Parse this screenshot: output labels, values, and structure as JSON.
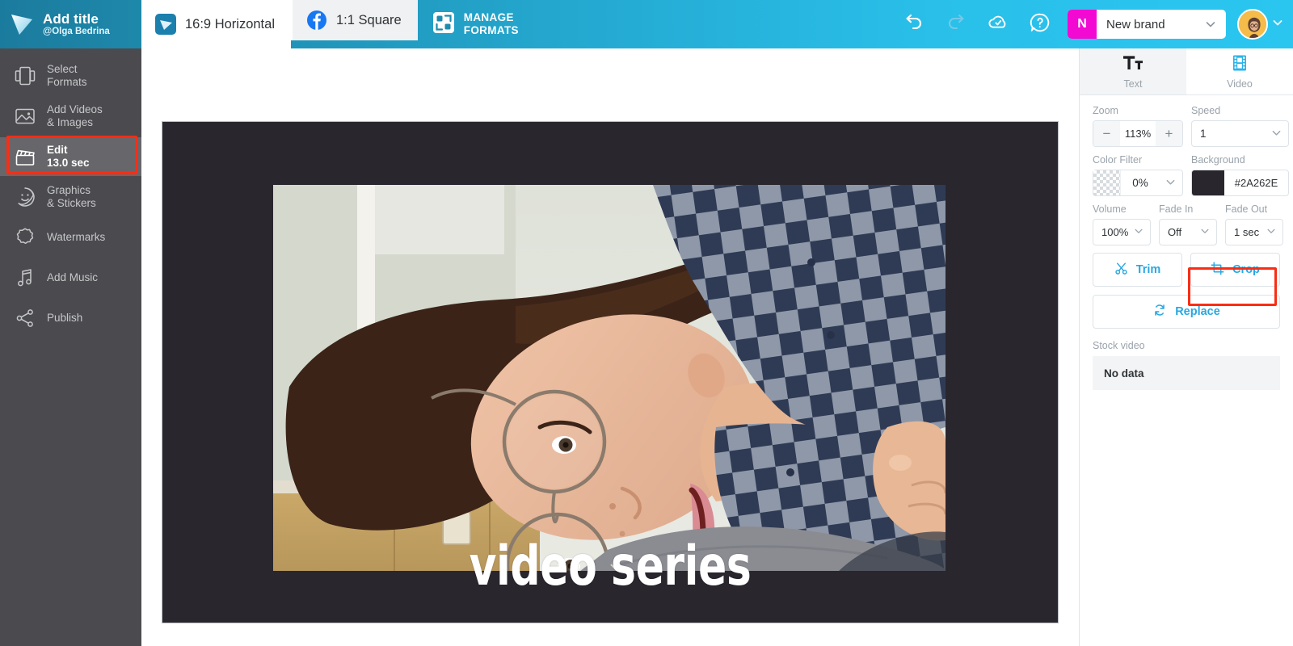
{
  "header": {
    "logo_icon": "play-logo-icon",
    "title": "Add title",
    "handle": "@Olga Bedrina",
    "format_tabs": [
      {
        "label": "16:9 Horizontal",
        "icon": "app-play-icon",
        "active": true
      },
      {
        "label": "1:1 Square",
        "icon": "facebook-icon",
        "active": false
      }
    ],
    "manage_formats_label": "MANAGE\nFORMATS",
    "manage_formats_icon": "manage-formats-icon",
    "actions": [
      {
        "name": "undo",
        "icon": "undo-icon",
        "enabled": true
      },
      {
        "name": "redo",
        "icon": "redo-icon",
        "enabled": false
      },
      {
        "name": "saved",
        "icon": "cloud-check-icon",
        "enabled": true
      },
      {
        "name": "help",
        "icon": "question-help-icon",
        "enabled": true
      }
    ],
    "brand_selector": {
      "badge": "N",
      "badge_color": "#f20ad3",
      "name": "New brand",
      "chevron": "chevron-down-icon"
    },
    "avatar": {
      "name": "user-avatar",
      "chevron": "chevron-down-icon"
    }
  },
  "sidebar": {
    "items": [
      {
        "label": "Select\nFormats",
        "icon": "formats-icon",
        "active": false
      },
      {
        "label": "Add Videos\n& Images",
        "icon": "image-icon",
        "active": false
      },
      {
        "label": "Edit\n13.0 sec",
        "icon": "clapperboard-icon",
        "active": true
      },
      {
        "label": "Graphics\n& Stickers",
        "icon": "sticker-smiley-icon",
        "active": false
      },
      {
        "label": "Watermarks",
        "icon": "watermark-badge-icon",
        "active": false
      },
      {
        "label": "Add Music",
        "icon": "music-note-icon",
        "active": false
      },
      {
        "label": "Publish",
        "icon": "share-icon",
        "active": false
      }
    ]
  },
  "canvas": {
    "background_color": "#2A262E",
    "caption_text": "video series"
  },
  "right_panel": {
    "tabs": [
      {
        "label": "Text",
        "icon": "text-format-icon",
        "selected": true
      },
      {
        "label": "Video",
        "icon": "film-strip-icon",
        "selected": false
      }
    ],
    "zoom": {
      "label": "Zoom",
      "value": "113%",
      "minus": "−",
      "plus": "+"
    },
    "speed": {
      "label": "Speed",
      "value": "1"
    },
    "color_filter": {
      "label": "Color Filter",
      "value": "0%"
    },
    "background": {
      "label": "Background",
      "value": "#2A262E",
      "color": "#2A262E"
    },
    "volume": {
      "label": "Volume",
      "value": "100%"
    },
    "fade_in": {
      "label": "Fade In",
      "value": "Off"
    },
    "fade_out": {
      "label": "Fade Out",
      "value": "1 sec"
    },
    "buttons": [
      {
        "label": "Trim",
        "icon": "scissors-icon"
      },
      {
        "label": "Crop",
        "icon": "crop-icon",
        "highlighted": true
      },
      {
        "label": "Replace",
        "icon": "refresh-replace-icon"
      }
    ],
    "stock_video": {
      "label": "Stock video",
      "empty_text": "No data"
    }
  },
  "annotations": {
    "color": "#fa2d14",
    "targets": [
      "sidebar-item-edit",
      "crop-button"
    ]
  }
}
